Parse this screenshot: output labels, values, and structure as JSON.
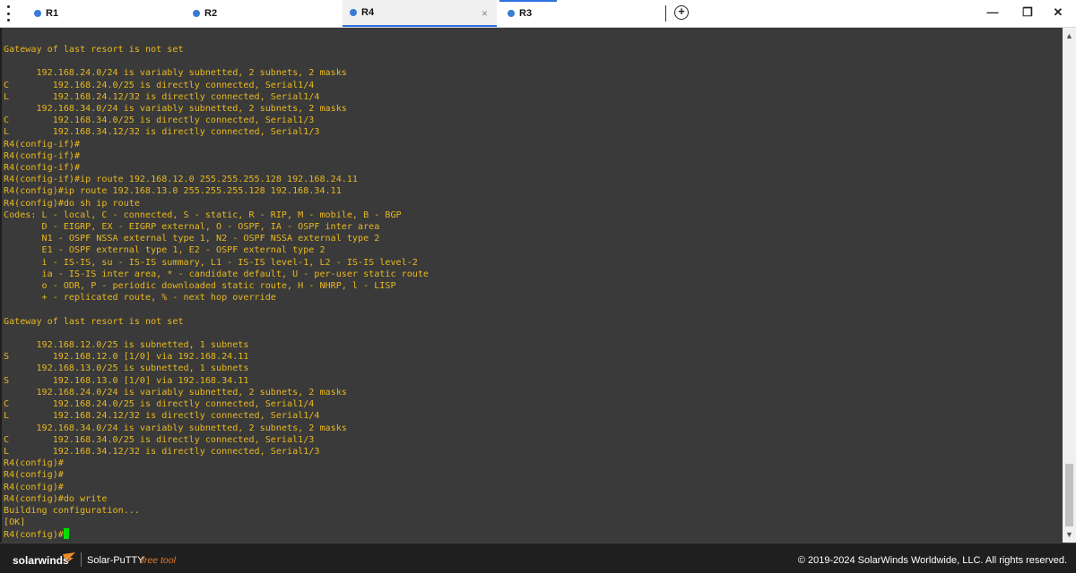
{
  "tabs": [
    {
      "label": "R1",
      "active": false
    },
    {
      "label": "R2",
      "active": false
    },
    {
      "label": "R4",
      "active": true
    },
    {
      "label": "R3",
      "active": false
    }
  ],
  "tab_close": "×",
  "add_tab": "+",
  "window": {
    "minimize": "—",
    "restore": "❐",
    "close": "✕"
  },
  "terminal": {
    "text": "Gateway of last resort is not set\n\n      192.168.24.0/24 is variably subnetted, 2 subnets, 2 masks\nC        192.168.24.0/25 is directly connected, Serial1/4\nL        192.168.24.12/32 is directly connected, Serial1/4\n      192.168.34.0/24 is variably subnetted, 2 subnets, 2 masks\nC        192.168.34.0/25 is directly connected, Serial1/3\nL        192.168.34.12/32 is directly connected, Serial1/3\nR4(config-if)#\nR4(config-if)#\nR4(config-if)#\nR4(config-if)#ip route 192.168.12.0 255.255.255.128 192.168.24.11\nR4(config)#ip route 192.168.13.0 255.255.255.128 192.168.34.11\nR4(config)#do sh ip route\nCodes: L - local, C - connected, S - static, R - RIP, M - mobile, B - BGP\n       D - EIGRP, EX - EIGRP external, O - OSPF, IA - OSPF inter area\n       N1 - OSPF NSSA external type 1, N2 - OSPF NSSA external type 2\n       E1 - OSPF external type 1, E2 - OSPF external type 2\n       i - IS-IS, su - IS-IS summary, L1 - IS-IS level-1, L2 - IS-IS level-2\n       ia - IS-IS inter area, * - candidate default, U - per-user static route\n       o - ODR, P - periodic downloaded static route, H - NHRP, l - LISP\n       + - replicated route, % - next hop override\n\nGateway of last resort is not set\n\n      192.168.12.0/25 is subnetted, 1 subnets\nS        192.168.12.0 [1/0] via 192.168.24.11\n      192.168.13.0/25 is subnetted, 1 subnets\nS        192.168.13.0 [1/0] via 192.168.34.11\n      192.168.24.0/24 is variably subnetted, 2 subnets, 2 masks\nC        192.168.24.0/25 is directly connected, Serial1/4\nL        192.168.24.12/32 is directly connected, Serial1/4\n      192.168.34.0/24 is variably subnetted, 2 subnets, 2 masks\nC        192.168.34.0/25 is directly connected, Serial1/3\nL        192.168.34.12/32 is directly connected, Serial1/3\nR4(config)#\nR4(config)#\nR4(config)#\nR4(config)#do write\nBuilding configuration...\n[OK]\nR4(config)#",
    "colors": {
      "background": "#3a3a3a",
      "foreground": "#e8b820",
      "cursor": "#00e000"
    }
  },
  "footer": {
    "brand": "solarwinds",
    "app_name": "Solar-PuTTY",
    "free_label": "free tool",
    "copyright": "© 2019-2024 SolarWinds Worldwide, LLC. All rights reserved."
  },
  "accent": "#2f6fde"
}
